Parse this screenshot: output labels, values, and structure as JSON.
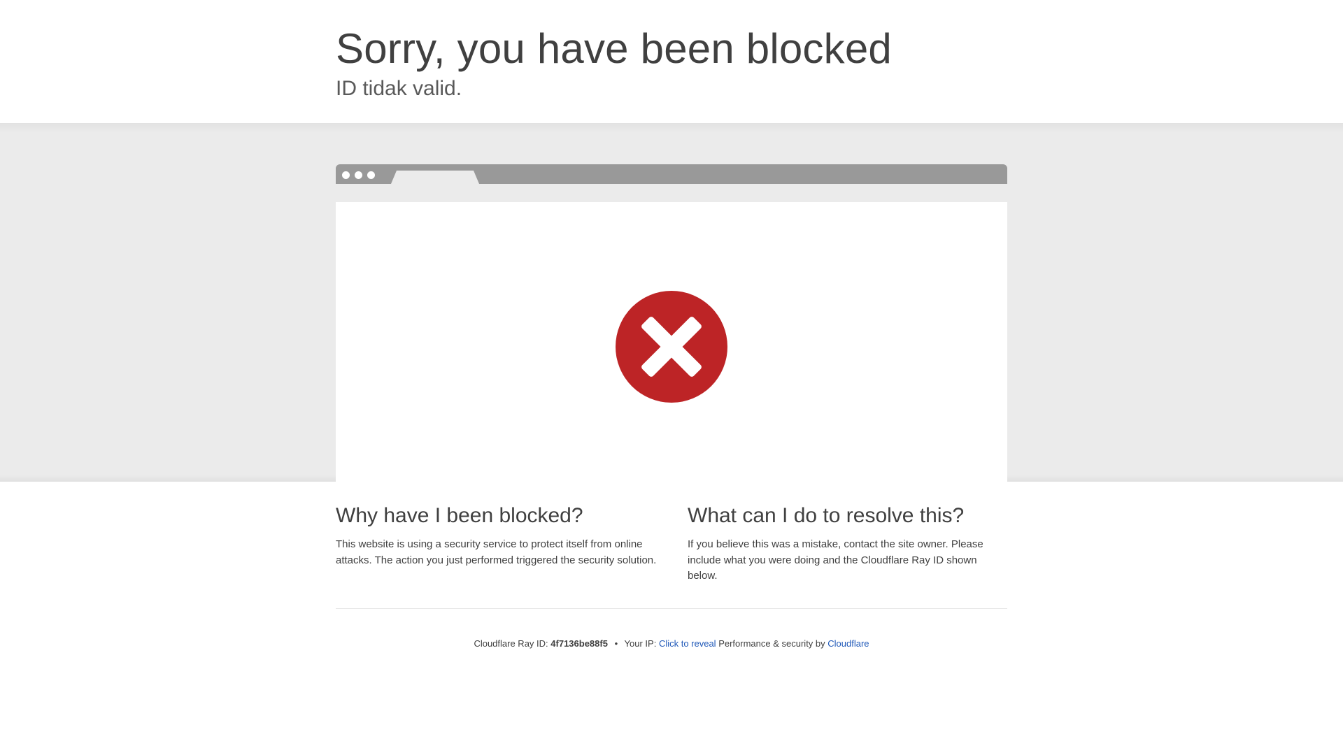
{
  "header": {
    "title": "Sorry, you have been blocked",
    "subtitle": "ID tidak valid."
  },
  "illustration": {
    "icon": "blocked-x-icon",
    "icon_color": "#bd2426",
    "bar_color": "#999999"
  },
  "why_section": {
    "heading": "Why have I been blocked?",
    "body": "This website is using a security service to protect itself from online attacks. The action you just performed triggered the security solution."
  },
  "resolve_section": {
    "heading": "What can I do to resolve this?",
    "body": "If you believe this was a mistake, contact the site owner. Please include what you were doing and the Cloudflare Ray ID shown below."
  },
  "footer": {
    "ray_label": "Cloudflare Ray ID:",
    "ray_id": "4f7136be88f5",
    "bullet": "•",
    "ip_label": "Your IP:",
    "ip_reveal_link": "Click to reveal",
    "perf_label": "Performance & security by",
    "cloudflare_link": "Cloudflare",
    "link_color": "#1f58b8"
  }
}
